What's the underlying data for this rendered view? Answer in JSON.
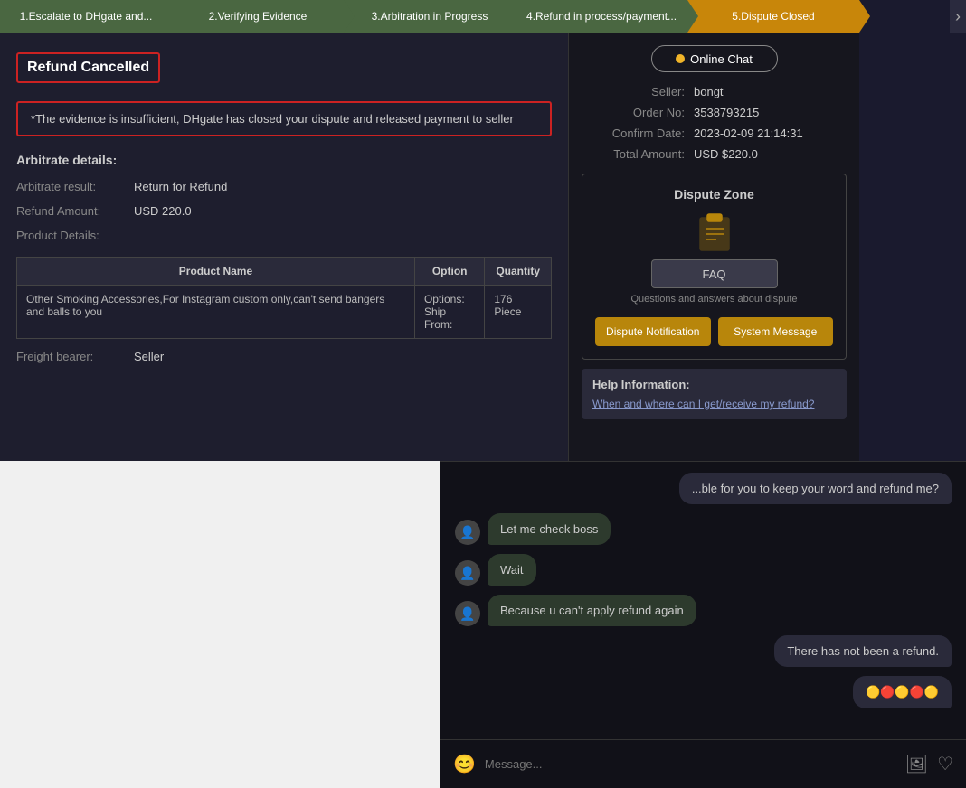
{
  "progress": {
    "steps": [
      {
        "id": "step1",
        "label": "1.Escalate to DHgate and...",
        "state": "done"
      },
      {
        "id": "step2",
        "label": "2.Verifying Evidence",
        "state": "done"
      },
      {
        "id": "step3",
        "label": "3.Arbitration in Progress",
        "state": "done"
      },
      {
        "id": "step4",
        "label": "4.Refund in process/payment...",
        "state": "done"
      },
      {
        "id": "step5",
        "label": "5.Dispute Closed",
        "state": "active"
      }
    ]
  },
  "left": {
    "refund_cancelled": "Refund Cancelled",
    "evidence_text": "*The evidence is insufficient, DHgate has closed your dispute and released payment to seller",
    "arbitrate_title": "Arbitrate details:",
    "arbitrate_result_label": "Arbitrate result:",
    "arbitrate_result_value": "Return for Refund",
    "refund_amount_label": "Refund Amount:",
    "refund_amount_value": "USD 220.0",
    "product_details_label": "Product Details:",
    "table": {
      "headers": [
        "Product Name",
        "Option",
        "Quantity"
      ],
      "rows": [
        {
          "name": "Other Smoking Accessories,For Instagram custom only,can't send bangers and balls to you",
          "option_label1": "Options:",
          "option_label2": "Ship From:",
          "quantity": "176 Piece"
        }
      ]
    },
    "freight_label": "Freight bearer:",
    "freight_value": "Seller"
  },
  "right": {
    "online_chat": "Online Chat",
    "seller_label": "Seller:",
    "seller_value": "bongt",
    "order_no_label": "Order No:",
    "order_no_value": "3538793215",
    "confirm_date_label": "Confirm Date:",
    "confirm_date_value": "2023-02-09 21:14:31",
    "total_amount_label": "Total Amount:",
    "total_amount_value": "USD $220.0",
    "dispute_zone_title": "Dispute Zone",
    "faq_btn_label": "FAQ",
    "faq_subtitle": "Questions and answers about dispute",
    "dispute_notif_btn": "Dispute Notification",
    "system_msg_btn": "System Message",
    "help_title": "Help Information:",
    "help_link": "When and where can I get/receive my refund?"
  },
  "chat": {
    "messages": [
      {
        "id": "msg1",
        "side": "right",
        "text": "...ble for you to keep your word and refund me?"
      },
      {
        "id": "msg2",
        "side": "left",
        "text": "Let me check boss"
      },
      {
        "id": "msg3",
        "side": "left",
        "text": "Wait"
      },
      {
        "id": "msg4",
        "side": "left",
        "text": "Because u can't apply refund again"
      },
      {
        "id": "msg5",
        "side": "right",
        "text": "There has not been a refund."
      },
      {
        "id": "msg6",
        "side": "right",
        "text": "🟡🔴🟡🔴🟡"
      }
    ],
    "input_placeholder": "Message...",
    "emoji_icon": "😊",
    "image_icon": "🖼",
    "heart_icon": "♡"
  }
}
